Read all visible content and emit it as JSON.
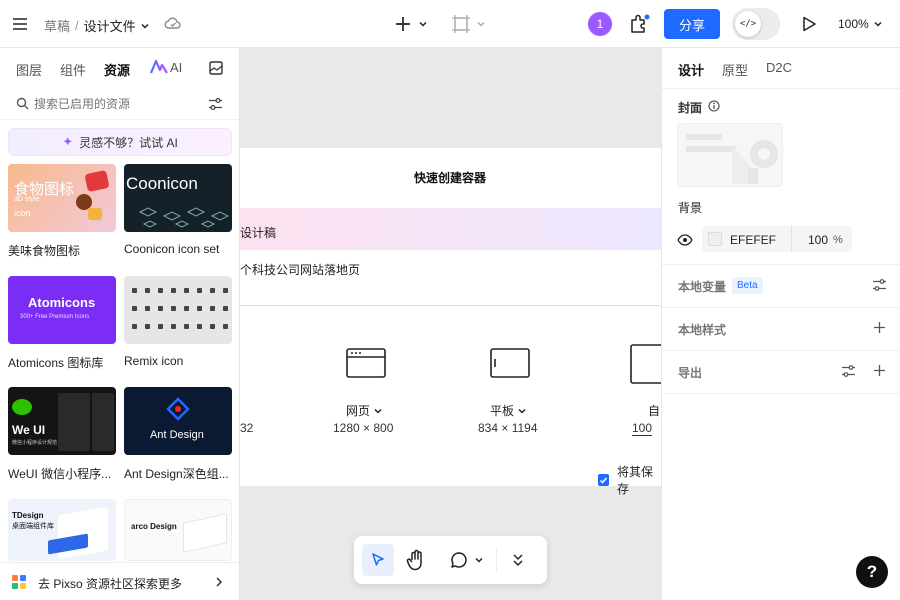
{
  "header": {
    "breadcrumb_root": "草稿",
    "breadcrumb_sep": "/",
    "file_name": "设计文件",
    "avatar_count": "1",
    "share_label": "分享",
    "dev_mode_glyph": "</>",
    "zoom": "100%"
  },
  "left": {
    "tabs": [
      {
        "label": "图层"
      },
      {
        "label": "组件"
      },
      {
        "label": "资源"
      },
      {
        "label": "AI"
      }
    ],
    "search_placeholder": "搜索已启用的资源",
    "ai_banner": "灵感不够？试试 AI",
    "resources": [
      {
        "label": "美味食物图标",
        "thumb_text": "食物图标",
        "thumb_sub": "icon",
        "thumb_small": "3D style"
      },
      {
        "label": "Coonicon icon set",
        "thumb_text": "Coonicon"
      },
      {
        "label": "Atomicons 图标库",
        "thumb_text": "Atomicons",
        "thumb_sub": "300+ Free Premium Icons"
      },
      {
        "label": "Remix icon"
      },
      {
        "label": "WeUI 微信小程序...",
        "thumb_text": "We UI",
        "thumb_sub": "微信小程序设计规范"
      },
      {
        "label": "Ant Design深色组...",
        "thumb_text": "Ant Design"
      },
      {
        "thumb_text": "TDesign",
        "thumb_sub": "桌面端组件库"
      },
      {
        "thumb_text": "arco Design"
      }
    ],
    "bottom_link": "去 Pixso 资源社区探索更多"
  },
  "canvas": {
    "quick_create": "快速创建容器",
    "ai_title_partial": "设计稿",
    "ai_prompt_partial": "个科技公司网站落地页",
    "frames": [
      {
        "name": "网页",
        "size": "1280 × 800"
      },
      {
        "name": "平板",
        "size": "834 × 1194"
      },
      {
        "name": "自",
        "size": "100"
      }
    ],
    "left_partial_size": "32",
    "checkbox_label": "将其保存"
  },
  "right": {
    "tabs": [
      {
        "label": "设计"
      },
      {
        "label": "原型"
      },
      {
        "label": "D2C"
      }
    ],
    "cover_label": "封面",
    "background_label": "背景",
    "bg_color": "EFEFEF",
    "bg_opacity": "100",
    "bg_opacity_unit": "%",
    "local_vars": "本地变量",
    "beta": "Beta",
    "local_styles": "本地样式",
    "export": "导出"
  },
  "colors": {
    "accent": "#1f6bff",
    "avatar": "#9b59ff",
    "canvas_bg": "#e9e9e9",
    "bg_swatch": "#EFEFEF"
  },
  "help": "?"
}
